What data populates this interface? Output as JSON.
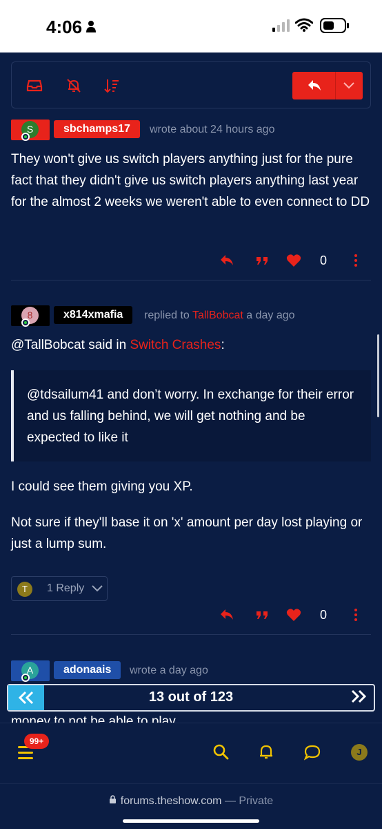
{
  "status_bar": {
    "time": "4:06"
  },
  "posts": [
    {
      "avatar_letter": "S",
      "username": "sbchamps17",
      "meta": "wrote about 24 hours ago",
      "body": "They won't give us switch players anything just for the pure fact that they didn't give us switch players anything last year for the almost 2 weeks we weren't able to even connect to DD",
      "vote_count": "0"
    },
    {
      "avatar_letter": "8",
      "username": "x814xmafia",
      "meta_prefix": "replied to",
      "reply_to": "TallBobcat",
      "meta_suffix": "a day ago",
      "quote_intro": "@TallBobcat said in",
      "quote_topic": "Switch Crashes",
      "quote_colon": ":",
      "quote_text": "@tdsailum41 and don’t worry. In exchange for their error and us falling behind, we will get nothing and be expected to like it",
      "para1": "I could see them giving you XP.",
      "para2": "Not sure if they'll base it on 'x' amount per day lost playing or just a lump sum.",
      "replies_avatar": "T",
      "replies_label": "1 Reply",
      "vote_count": "0"
    },
    {
      "avatar_letter": "A",
      "username": "adonaais",
      "meta": "wrote a day ago",
      "partial_body": "money to not be able to play"
    }
  ],
  "pagination": {
    "label": "13 out of 123"
  },
  "bottom_nav": {
    "notifications_badge": "99+",
    "user_avatar": "J"
  },
  "browser": {
    "domain": "forums.theshow.com",
    "separator": " — ",
    "mode": "Private"
  },
  "colors": {
    "background": "#0b1d44",
    "accent": "#e8231b",
    "pager_accent": "#2fb3e6",
    "icon_yellow": "#f2c300"
  }
}
